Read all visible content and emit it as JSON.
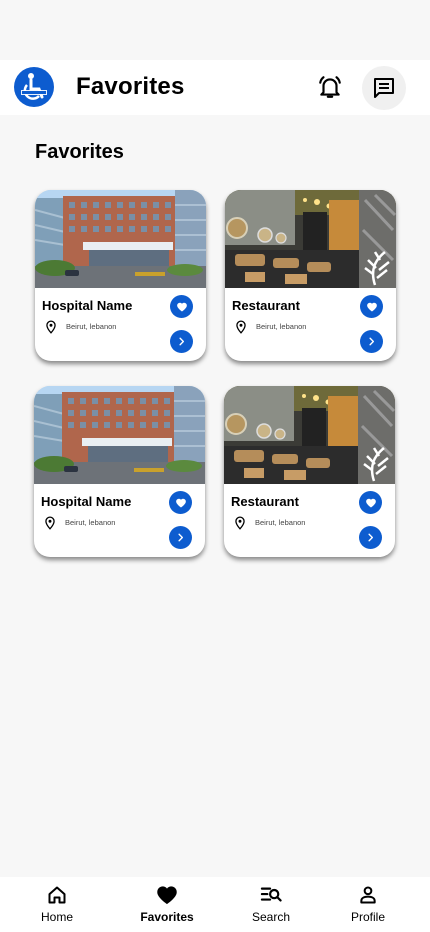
{
  "header": {
    "title": "Favorites",
    "logo_icon": "wheelchair-logo-icon",
    "bell_icon": "bell-icon",
    "chat_icon": "chat-icon"
  },
  "section": {
    "title": "Favorites"
  },
  "cards": [
    {
      "name": "Hospital Name",
      "location": "Beirut, lebanon",
      "image": "hospital-photo"
    },
    {
      "name": "Restaurant",
      "location": "Beirut, lebanon",
      "image": "restaurant-photo"
    },
    {
      "name": "Hospital Name",
      "location": "Beirut, lebanon",
      "image": "hospital-photo"
    },
    {
      "name": "Restaurant",
      "location": "Beirut, lebanon",
      "image": "restaurant-photo"
    }
  ],
  "tabs": [
    {
      "label": "Home",
      "icon": "home-icon"
    },
    {
      "label": "Favorites",
      "icon": "heart-icon",
      "active": true
    },
    {
      "label": "Search",
      "icon": "search-list-icon"
    },
    {
      "label": "Profile",
      "icon": "person-icon"
    }
  ],
  "colors": {
    "accent": "#0d5ccf",
    "background": "#f7f7f7"
  }
}
